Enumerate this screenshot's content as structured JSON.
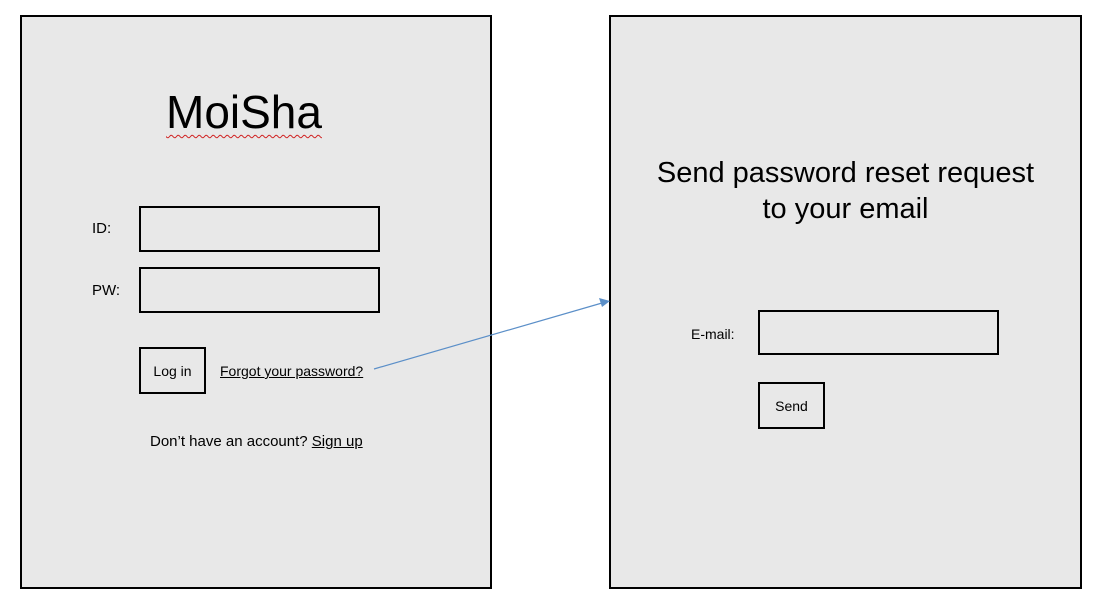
{
  "login_screen": {
    "app_title": "MoiSha",
    "id_label": "ID:",
    "id_value": "",
    "pw_label": "PW:",
    "pw_value": "",
    "login_button": "Log in",
    "forgot_link": "Forgot your password?",
    "signup_prompt": "Don’t have an account?",
    "signup_link": "Sign up"
  },
  "reset_screen": {
    "title_line1": "Send password reset request",
    "title_line2": "to your email",
    "email_label": "E-mail:",
    "email_value": "",
    "send_button": "Send"
  },
  "colors": {
    "panel_background": "#e8e8e8",
    "connector_arrow": "#5b8fc8",
    "spellcheck_underline": "#d02020"
  }
}
